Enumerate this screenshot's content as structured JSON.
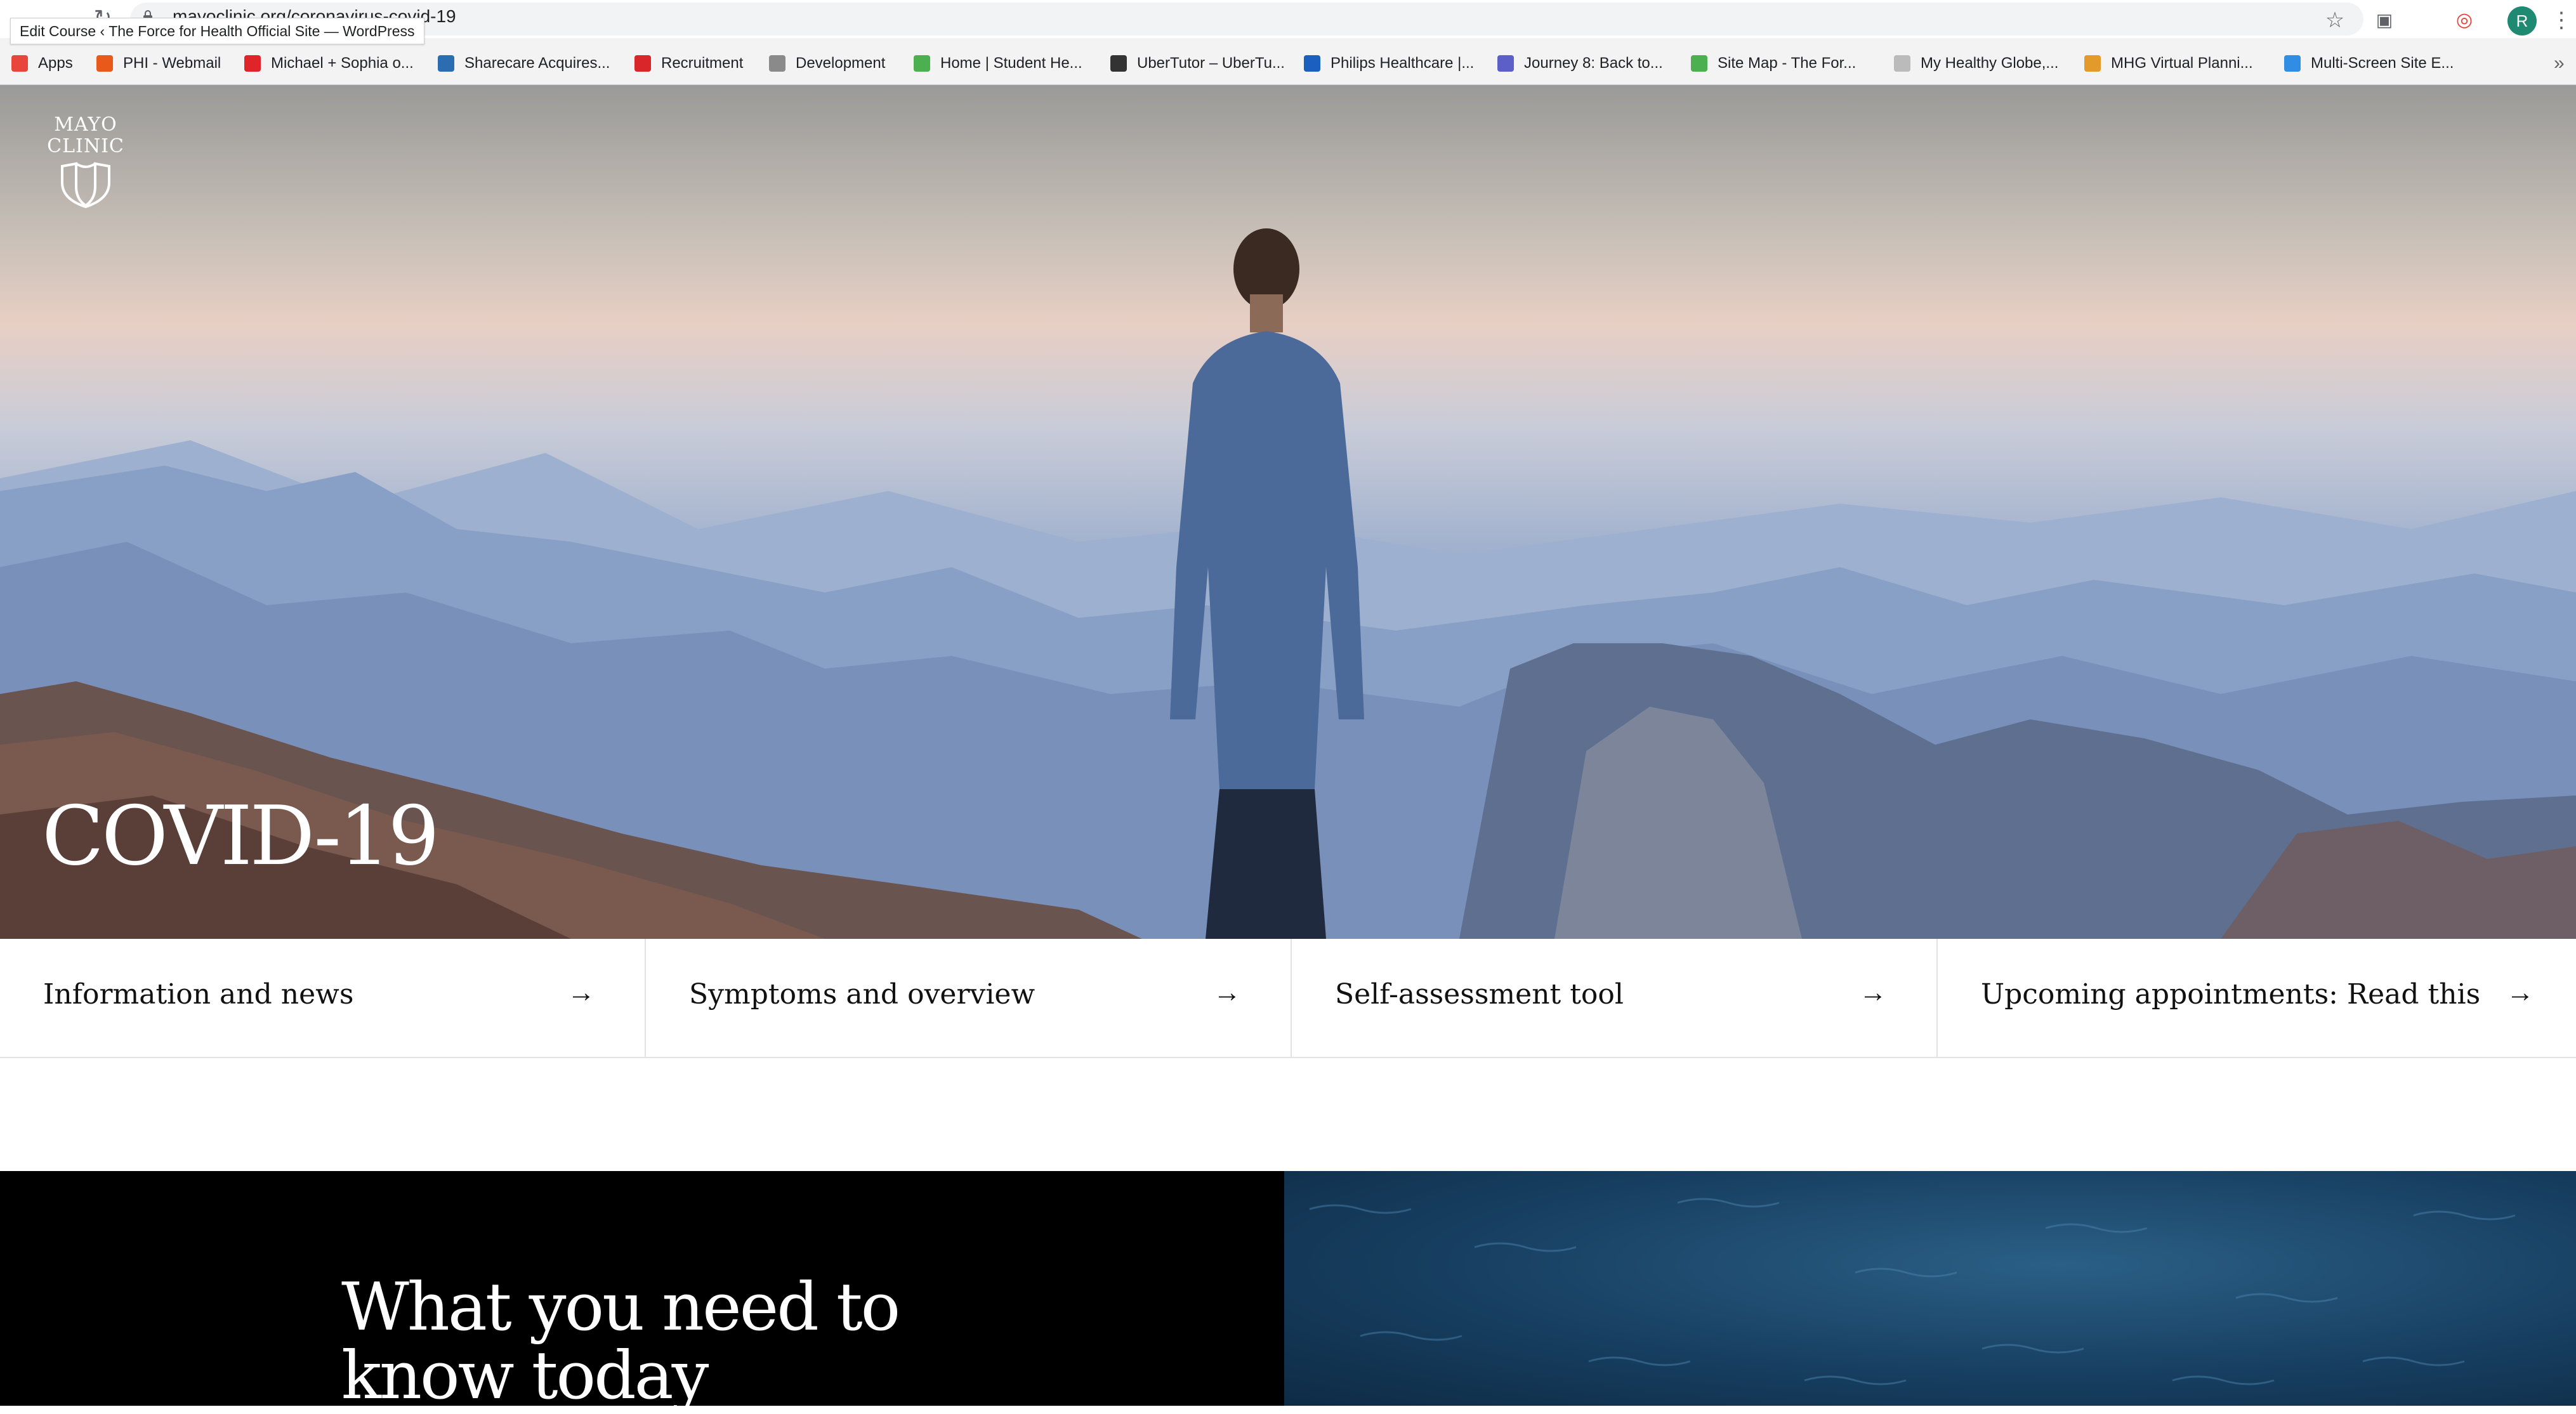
{
  "browser": {
    "url": "mayoclinic.org/coronavirus-covid-19",
    "tooltip": "Edit Course ‹ The Force for Health Official Site — WordPress",
    "profile_initial": "R",
    "bookmarks": [
      {
        "label": "Apps",
        "icon": "apps-grid-icon",
        "color": "#e8453c"
      },
      {
        "label": "PHI - Webmail",
        "icon": "webmail-icon",
        "color": "#e8591a"
      },
      {
        "label": "Michael + Sophia o...",
        "icon": "z-logo-icon",
        "color": "#e0252a"
      },
      {
        "label": "Sharecare Acquires...",
        "icon": "search-favicon-icon",
        "color": "#2c6cb0"
      },
      {
        "label": "Recruitment",
        "icon": "adp-icon",
        "color": "#d8262b"
      },
      {
        "label": "Development",
        "icon": "folder-icon",
        "color": "#8a8a8a"
      },
      {
        "label": "Home | Student He...",
        "icon": "wifi-favicon-icon",
        "color": "#4caf50"
      },
      {
        "label": "UberTutor – UberTu...",
        "icon": "globe-icon",
        "color": "#333333"
      },
      {
        "label": "Philips Healthcare |...",
        "icon": "shield-favicon-icon",
        "color": "#1b5fbf"
      },
      {
        "label": "Journey 8: Back to...",
        "icon": "circle-favicon-icon",
        "color": "#5b5fc7"
      },
      {
        "label": "Site Map - The For...",
        "icon": "wifi-favicon-icon",
        "color": "#4caf50"
      },
      {
        "label": "My Healthy Globe,...",
        "icon": "default-favicon-icon",
        "color": "#bbbbbb"
      },
      {
        "label": "MHG Virtual Planni...",
        "icon": "mh-favicon-icon",
        "color": "#e39a2b"
      },
      {
        "label": "Multi-Screen Site E...",
        "icon": "phone-favicon-icon",
        "color": "#2f8de4"
      }
    ]
  },
  "brand": {
    "logo_line1": "MAYO",
    "logo_line2": "CLINIC"
  },
  "hero": {
    "title": "COVID-19"
  },
  "links": [
    {
      "label": "Information and news",
      "arrow": "→"
    },
    {
      "label": "Symptoms and overview",
      "arrow": "→"
    },
    {
      "label": "Self-assessment tool",
      "arrow": "→"
    },
    {
      "label": "Upcoming appointments: Read this",
      "arrow": "→"
    }
  ],
  "section": {
    "title": "What you need to know today"
  }
}
